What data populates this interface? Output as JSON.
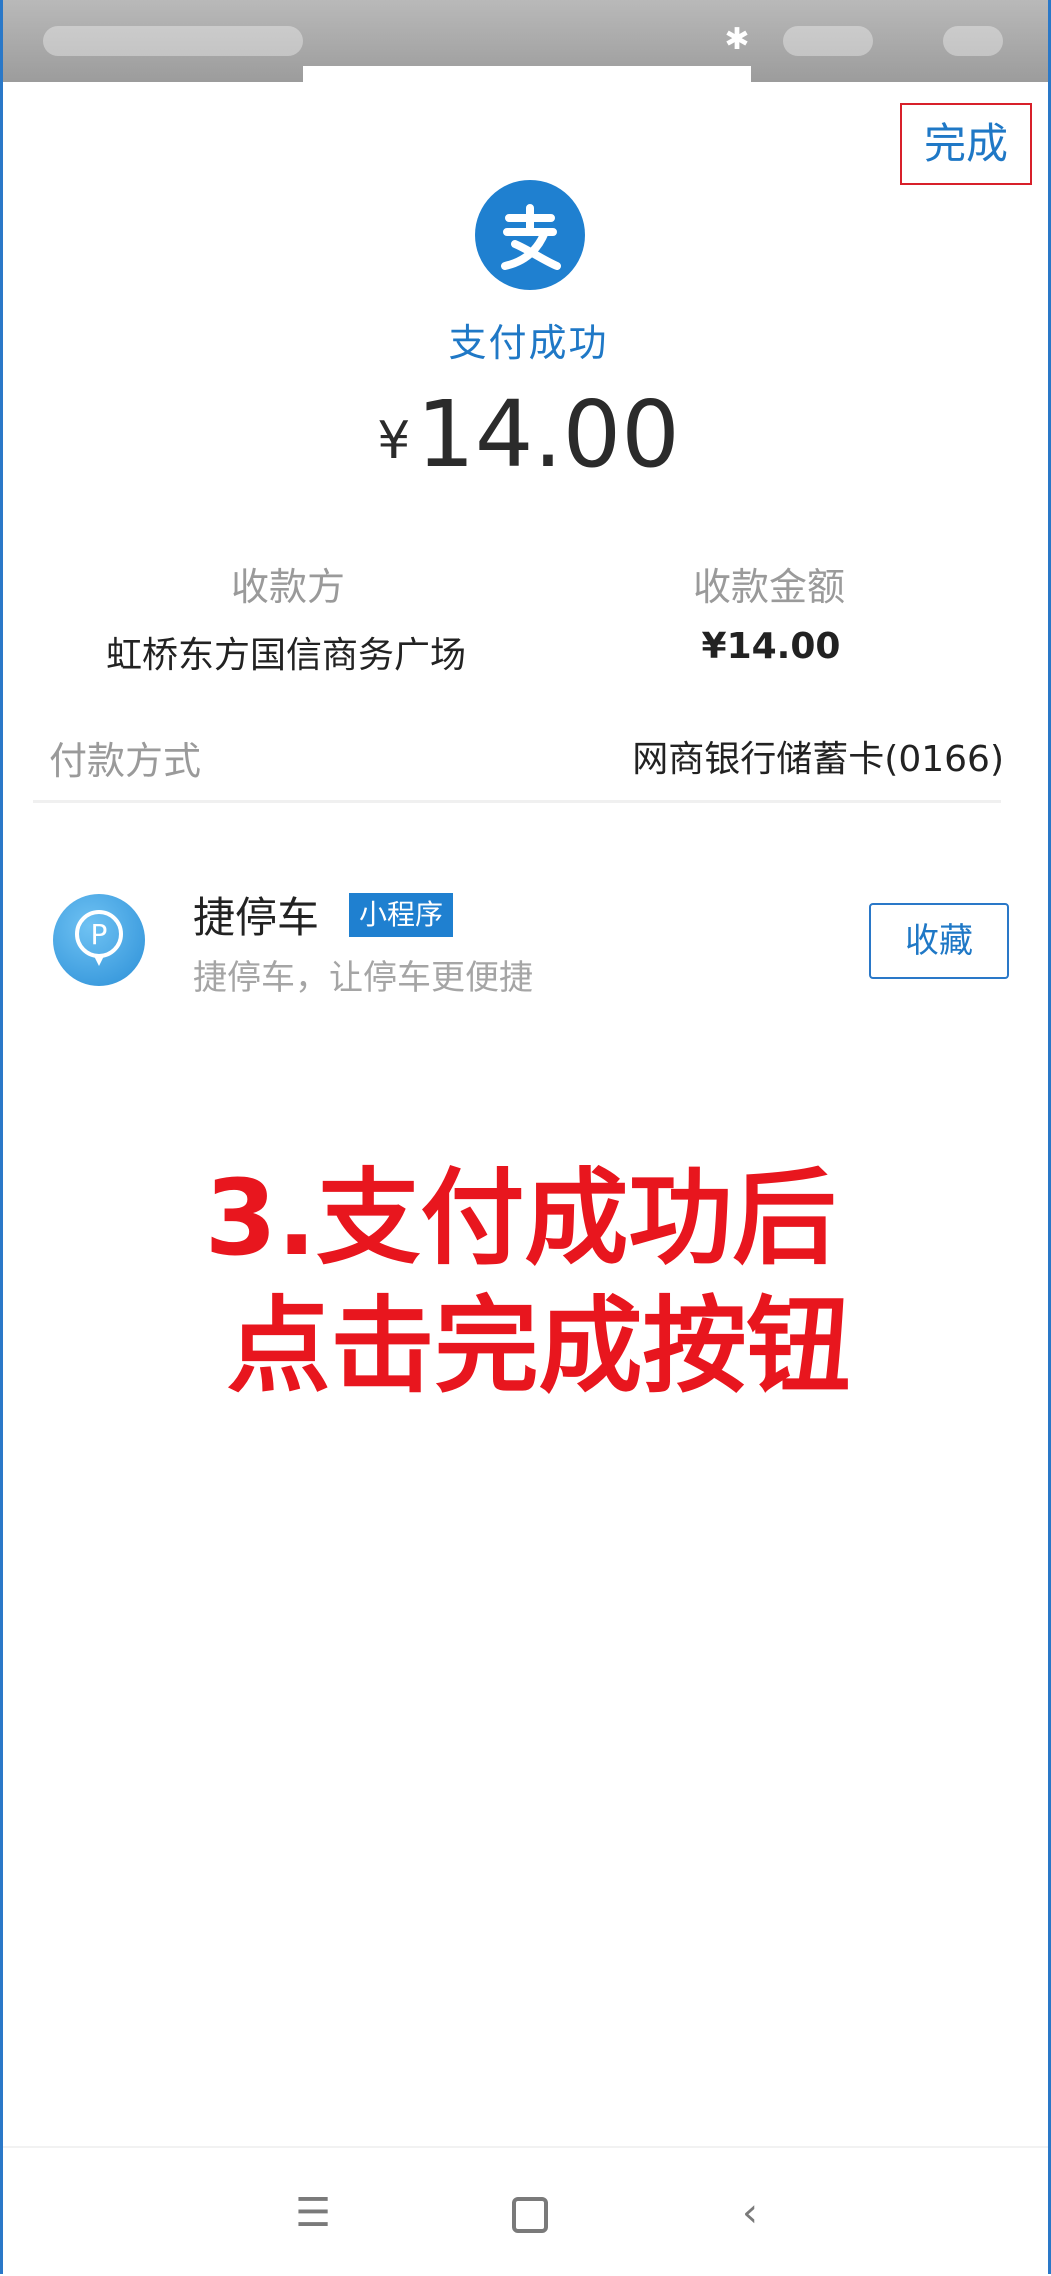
{
  "header": {
    "done_label": "完成"
  },
  "result": {
    "status": "支付成功",
    "currency_symbol": "¥",
    "amount": "14.00"
  },
  "details": {
    "payee_label": "收款方",
    "payee_value": "虹桥东方国信商务广场",
    "amount_label": "收款金额",
    "amount_value": "¥14.00",
    "payment_method_label": "付款方式",
    "payment_method_value": "网商银行储蓄卡(0166)"
  },
  "mini_program": {
    "name": "捷停车",
    "badge": "小程序",
    "description": "捷停车，让停车更便捷",
    "favorite_label": "收藏",
    "icon": "parking-icon"
  },
  "instruction": {
    "line1": "3.支付成功后",
    "line2": "点击完成按钮"
  },
  "navbar": {
    "menu_icon": "menu-icon",
    "home_icon": "home-icon",
    "back_icon": "back-icon"
  },
  "colors": {
    "accent": "#1f78c6",
    "highlight_red": "#e8161e",
    "frame_border": "#d8202a"
  }
}
